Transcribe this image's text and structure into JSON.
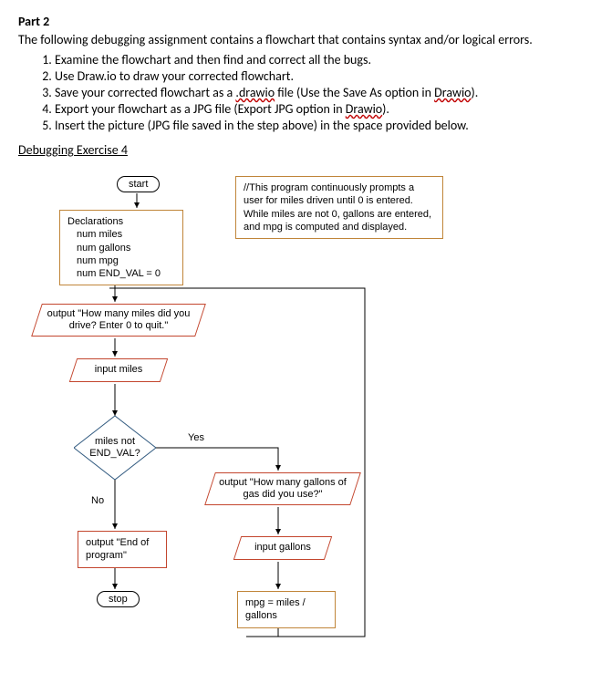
{
  "header": {
    "part": "Part 2",
    "intro": "The following debugging assignment contains a flowchart that contains syntax and/or logical errors.",
    "steps": [
      "Examine the flowchart and then find and correct all the bugs.",
      "Use Draw.io to draw your corrected flowchart.",
      "Save your corrected flowchart as a ",
      "Export your flowchart as a JPG file (Export JPG option in ",
      "Insert the picture (JPG file saved in the step above) in the space provided below."
    ],
    "step3_wavy": ".drawio",
    "step3_tail": " file (Use the Save As option in ",
    "step3_wavy2": "Drawio",
    "step3_end": ").",
    "step4_wavy": "Drawio",
    "step4_end": ").",
    "section": "Debugging Exercise 4"
  },
  "flow": {
    "start": "start",
    "declarations_title": "Declarations",
    "decl1": "num miles",
    "decl2": "num gallons",
    "decl3": "num mpg",
    "decl4": "num END_VAL = 0",
    "comment": "//This program continuously prompts a user for miles driven until 0 is entered. While miles are not 0, gallons are entered, and mpg is computed and displayed.",
    "prompt_miles": "output \"How many miles did you drive? Enter 0 to quit.\"",
    "input_miles": "input miles",
    "decision": "miles not END_VAL?",
    "yes": "Yes",
    "no": "No",
    "end_prog": "output \"End of program\"",
    "stop": "stop",
    "prompt_gal": "output \"How many gallons of gas did you use?\"",
    "input_gal": "input gallons",
    "calc": "mpg = miles / gallons"
  }
}
